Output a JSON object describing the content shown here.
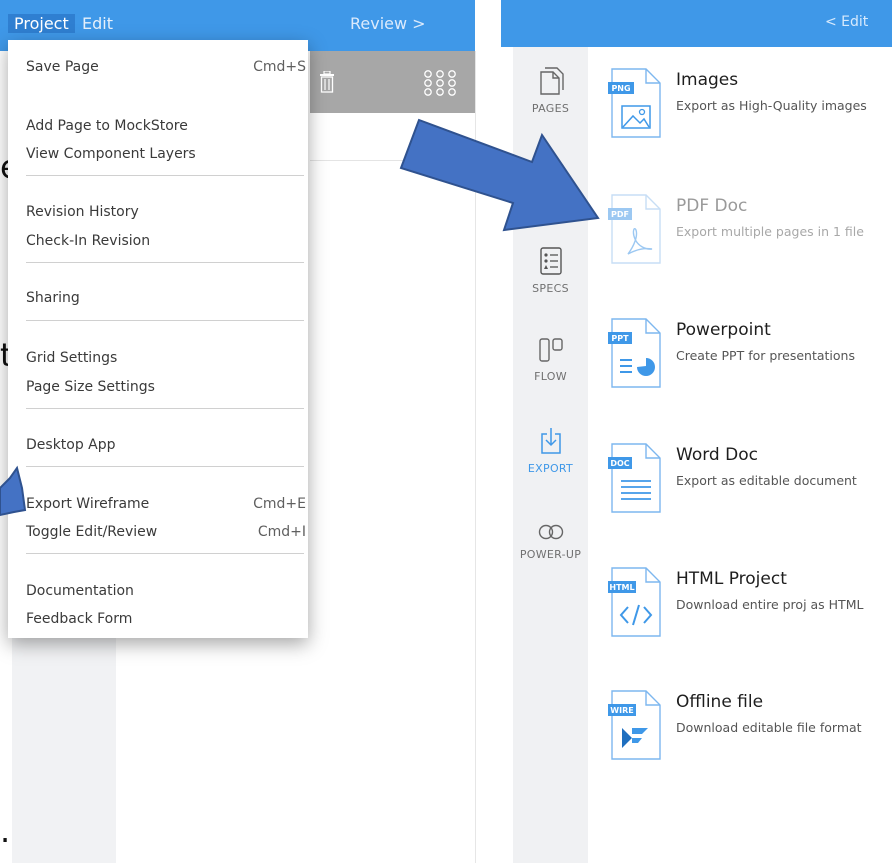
{
  "left_app": {
    "menu_bar": {
      "project": "Project",
      "edit": "Edit",
      "review": "Review  >"
    },
    "background_fragments": {
      "letter_e": "e",
      "letter_t": "t",
      "dot": "."
    }
  },
  "project_menu": {
    "items": [
      {
        "label": "Save Page",
        "shortcut": "Cmd+S"
      },
      {
        "label": "Add Page to MockStore",
        "shortcut": ""
      },
      {
        "label": "View Component Layers",
        "shortcut": ""
      },
      {
        "label": "Revision History",
        "shortcut": ""
      },
      {
        "label": "Check-In Revision",
        "shortcut": ""
      },
      {
        "label": "Sharing",
        "shortcut": ""
      },
      {
        "label": "Grid Settings",
        "shortcut": ""
      },
      {
        "label": "Page Size Settings",
        "shortcut": ""
      },
      {
        "label": "Desktop App",
        "shortcut": ""
      },
      {
        "label": "Export Wireframe",
        "shortcut": "Cmd+E"
      },
      {
        "label": "Toggle Edit/Review",
        "shortcut": "Cmd+I"
      },
      {
        "label": "Documentation",
        "shortcut": ""
      },
      {
        "label": "Feedback Form",
        "shortcut": ""
      }
    ]
  },
  "right_app": {
    "edit_back": "<  Edit",
    "sidebar": [
      {
        "label": "PAGES",
        "icon": "pages-icon"
      },
      {
        "label": "SPECS",
        "icon": "specs-icon"
      },
      {
        "label": "FLOW",
        "icon": "flow-icon"
      },
      {
        "label": "EXPORT",
        "icon": "export-icon",
        "active": true
      },
      {
        "label": "POWER-UP",
        "icon": "power-up-icon"
      }
    ],
    "exports": [
      {
        "badge": "PNG",
        "title": "Images",
        "desc": "Export as High-Quality images"
      },
      {
        "badge": "PDF",
        "title": "PDF Doc",
        "desc": "Export multiple pages in 1 file"
      },
      {
        "badge": "PPT",
        "title": "Powerpoint",
        "desc": "Create PPT for presentations"
      },
      {
        "badge": "DOC",
        "title": "Word Doc",
        "desc": "Export as editable document"
      },
      {
        "badge": "HTML",
        "title": "HTML Project",
        "desc": "Download entire proj as HTML"
      },
      {
        "badge": "WIRE",
        "title": "Offline file",
        "desc": "Download editable file format"
      }
    ]
  },
  "colors": {
    "accent": "#3f98e8",
    "arrow_fill": "#4472c4",
    "arrow_stroke": "#2f528f"
  }
}
